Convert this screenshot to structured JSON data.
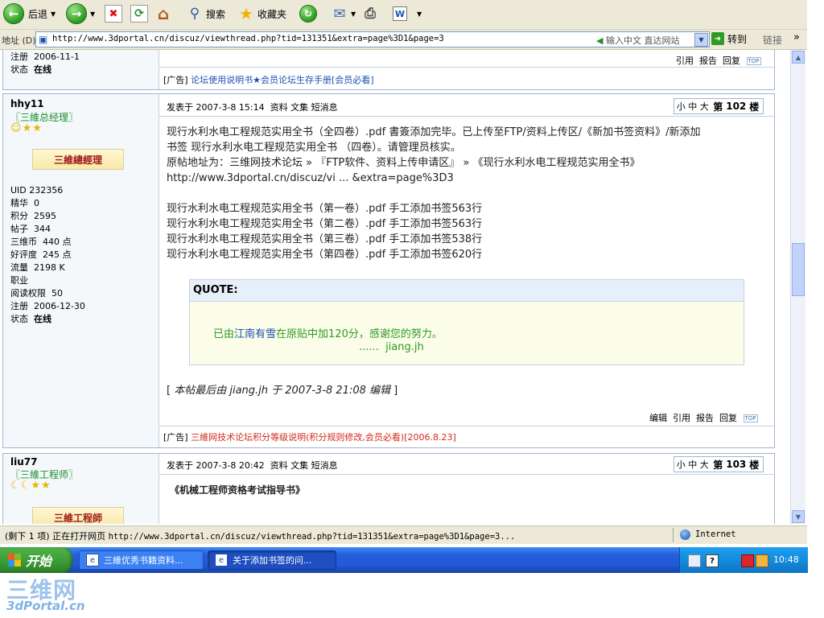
{
  "toolbar": {
    "back_label": "后退",
    "search_label": "搜索",
    "favorites_label": "收藏夹"
  },
  "address": {
    "label": "地址 (D)",
    "url": "http://www.3dportal.cn/discuz/viewthread.php?tid=131351&extra=page%3D1&page=3",
    "input_hint": "输入中文 直达网站",
    "go_label": "转到",
    "links_label": "链接"
  },
  "post_top": {
    "reg_label": "注册",
    "reg_date": "2006-11-1",
    "status_label": "状态",
    "status_value": "在线",
    "ops": [
      "引用",
      "报告",
      "回复"
    ],
    "ad_prefix": "[广告]",
    "ad_text": "论坛使用说明书★会员论坛生存手册[会员必看]"
  },
  "post_102": {
    "author": "hhy11",
    "rank": "〖三維总经理〗",
    "badge": "三維總經理",
    "profile": [
      {
        "label": "UID",
        "value": "232356"
      },
      {
        "label": "精华",
        "value": "0"
      },
      {
        "label": "积分",
        "value": "2595"
      },
      {
        "label": "帖子",
        "value": "344"
      },
      {
        "label": "三维币",
        "value": "440 点"
      },
      {
        "label": "好评度",
        "value": "245 点"
      },
      {
        "label": "流量",
        "value": "2198 K"
      },
      {
        "label": "职业",
        "value": ""
      },
      {
        "label": "阅读权限",
        "value": "50"
      },
      {
        "label": "注册",
        "value": "2006-12-30"
      },
      {
        "label": "状态",
        "value": "在线"
      }
    ],
    "posted": "发表于 2007-3-8 15:14",
    "links": [
      "资料",
      "文集",
      "短消息"
    ],
    "floor_sizes": "小 中 大",
    "floor_label": "第",
    "floor_num": "102",
    "floor_unit": "楼",
    "lines": [
      "现行水利水电工程规范实用全书（全四卷）.pdf 書簽添加完毕。已上传至FTP/资料上传区/《新加书签资料》/新添加",
      "书签 现行水利水电工程规范实用全书 （四卷）。请管理员核实。",
      "原帖地址为：三维网技术论坛 » 『FTP软件、资料上传申请区』 » 《现行水利水电工程规范实用全书》",
      "http://www.3dportal.cn/discuz/vi ... &extra=page%3D3",
      "",
      "现行水利水电工程规范实用全书（第一卷）.pdf 手工添加书签563行",
      "现行水利水电工程规范实用全书（第二卷）.pdf 手工添加书签563行",
      "现行水利水电工程规范实用全书（第三卷）.pdf 手工添加书签538行",
      "现行水利水电工程规范实用全书（第四卷）.pdf 手工添加书签620行"
    ],
    "quote_title": "QUOTE:",
    "quote_line1_a": "已由",
    "quote_line1_b": "江南有雪",
    "quote_line1_c": "在原贴中加120分，感谢您的努力。",
    "quote_line2_dots": "......",
    "quote_line2_name": "jiang.jh",
    "edit_open": "[",
    "edit_note": "本帖最后由 jiang.jh 于 2007-3-8 21:08 编辑",
    "edit_close": "]",
    "ops": [
      "编辑",
      "引用",
      "报告",
      "回复"
    ],
    "ad_prefix": "[广告]",
    "ad_text": "三維网技术论坛积分等级说明(积分规则修改,会员必看)[2006.8.23]"
  },
  "post_103": {
    "author": "liu77",
    "rank": "〖三維工程师〗",
    "badge": "三維工程師",
    "posted": "发表于 2007-3-8 20:42",
    "links": [
      "资料",
      "文集",
      "短消息"
    ],
    "floor_sizes": "小 中 大",
    "floor_label": "第",
    "floor_num": "103",
    "floor_unit": "楼",
    "title": "《机械工程师资格考试指导书》"
  },
  "status": {
    "progress_text": "(剩下 1 项) 正在打开网页",
    "url": "http://www.3dportal.cn/discuz/viewthread.php?tid=131351&extra=page%3D1&page=3...",
    "zone": "Internet"
  },
  "taskbar": {
    "start": "开始",
    "tasks": [
      "三維优秀书籍资料...",
      "关于添加书签的问..."
    ],
    "clock": "10:48"
  },
  "watermark": {
    "brand": "三维网",
    "domain": "3dPortal.cn"
  },
  "colors": {
    "link_blue": "#1a4fb0",
    "ad_red": "#d12a1a",
    "green_text": "#2e9a24",
    "star_gold": "#e7b400"
  }
}
